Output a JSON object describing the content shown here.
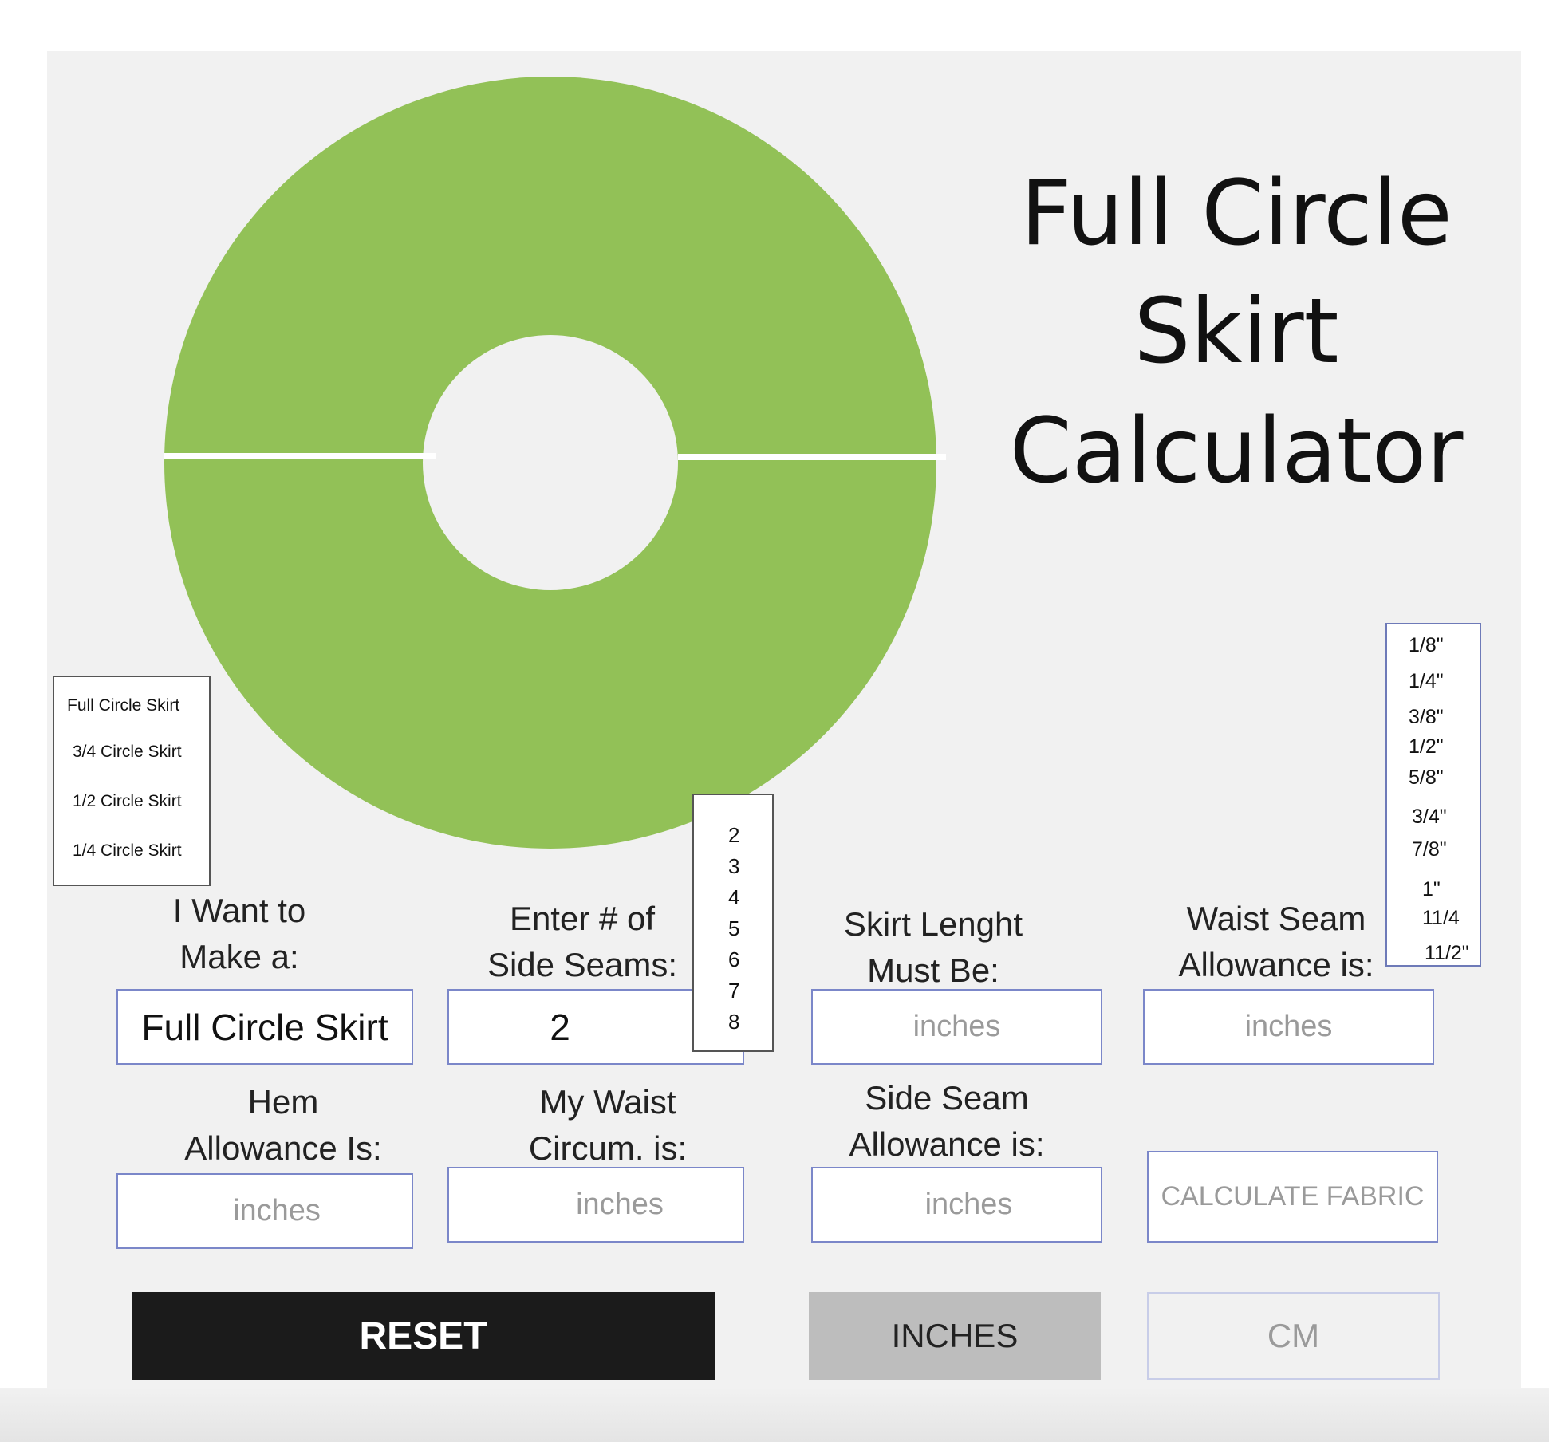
{
  "title": {
    "line1": "Full Circle",
    "line2": "Skirt",
    "line3": "Calculator"
  },
  "colors": {
    "skirt_green": "#92c157",
    "panel_bg": "#f1f1f1",
    "field_border": "#7b87c9",
    "reset_bg": "#1b1b1b",
    "inches_bg": "#bdbdbd"
  },
  "skirt_type": {
    "label_line1": "I Want to",
    "label_line2": "Make a:",
    "value": "Full Circle Skirt",
    "options": [
      "Full Circle Skirt",
      "3/4 Circle Skirt",
      "1/2 Circle Skirt",
      "1/4 Circle Skirt"
    ]
  },
  "side_seams": {
    "label_line1": "Enter # of",
    "label_line2": "Side Seams:",
    "value": "2",
    "options": [
      "2",
      "3",
      "4",
      "5",
      "6",
      "7",
      "8"
    ]
  },
  "skirt_length": {
    "label_line1": "Skirt Lenght",
    "label_line2": "Must Be:",
    "placeholder": "inches"
  },
  "waist_seam": {
    "label_line1": "Waist Seam",
    "label_line2": "Allowance is:",
    "placeholder": "inches",
    "options": [
      "1/8\"",
      "1/4\"",
      "3/8\"",
      "1/2\"",
      "5/8\"",
      "3/4\"",
      "7/8\"",
      "1\"",
      "11/4",
      "11/2\""
    ]
  },
  "hem_allowance": {
    "label_line1": "Hem",
    "label_line2": "Allowance Is:",
    "placeholder": "inches"
  },
  "waist_circum": {
    "label_line1": "My Waist",
    "label_line2": "Circum. is:",
    "placeholder": "inches"
  },
  "side_seam_allowance": {
    "label_line1": "Side Seam",
    "label_line2": "Allowance is:",
    "placeholder": "inches"
  },
  "buttons": {
    "calculate": "CALCULATE FABRIC",
    "reset": "RESET",
    "inches": "INCHES",
    "cm": "CM"
  }
}
